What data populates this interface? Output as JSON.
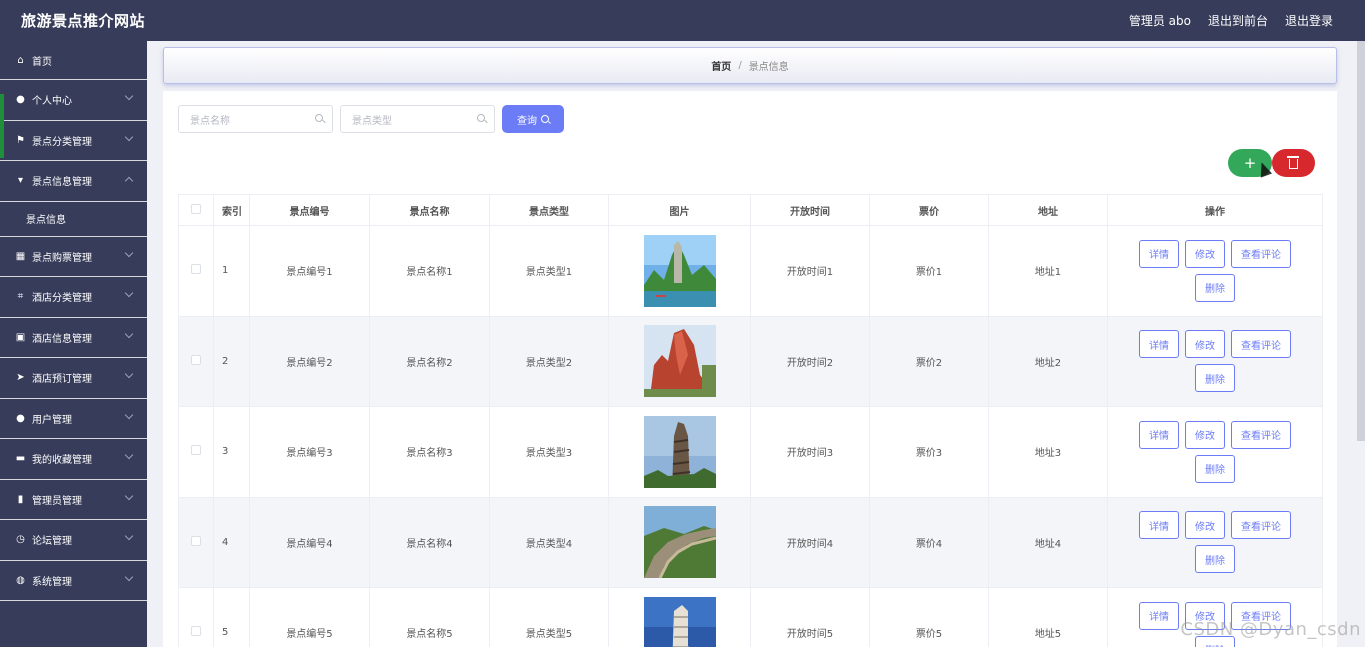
{
  "header": {
    "title": "旅游景点推介网站",
    "admin": "管理员 abo",
    "back_to_front": "退出到前台",
    "logout": "退出登录"
  },
  "sidebar": {
    "items": [
      {
        "label": "首页",
        "icon": "home-icon"
      },
      {
        "label": "个人中心",
        "icon": "user-icon"
      },
      {
        "label": "景点分类管理",
        "icon": "flag-icon"
      },
      {
        "label": "景点信息管理",
        "icon": "message-icon",
        "expanded": true,
        "sub": "景点信息"
      },
      {
        "label": "景点购票管理",
        "icon": "grid-icon"
      },
      {
        "label": "酒店分类管理",
        "icon": "crop-icon"
      },
      {
        "label": "酒店信息管理",
        "icon": "trash-icon"
      },
      {
        "label": "酒店预订管理",
        "icon": "send-icon"
      },
      {
        "label": "用户管理",
        "icon": "location-icon"
      },
      {
        "label": "我的收藏管理",
        "icon": "chat-icon"
      },
      {
        "label": "管理员管理",
        "icon": "chart-icon"
      },
      {
        "label": "论坛管理",
        "icon": "clock-icon"
      },
      {
        "label": "系统管理",
        "icon": "globe-icon"
      }
    ]
  },
  "breadcrumb": {
    "home": "首页",
    "separator": "/",
    "current": "景点信息"
  },
  "search": {
    "name_placeholder": "景点名称",
    "type_placeholder": "景点类型",
    "query_label": "查询"
  },
  "actions": {
    "add_label": "+"
  },
  "table": {
    "columns": [
      "索引",
      "景点编号",
      "景点名称",
      "景点类型",
      "图片",
      "开放时间",
      "票价",
      "地址",
      "操作"
    ],
    "rows": [
      {
        "index": "1",
        "code": "景点编号1",
        "name": "景点名称1",
        "type": "景点类型1",
        "image": "karst-peak-river",
        "open": "开放时间1",
        "price": "票价1",
        "address": "地址1"
      },
      {
        "index": "2",
        "code": "景点编号2",
        "name": "景点名称2",
        "type": "景点类型2",
        "image": "red-rock-formation",
        "open": "开放时间2",
        "price": "票价2",
        "address": "地址2"
      },
      {
        "index": "3",
        "code": "景点编号3",
        "name": "景点名称3",
        "type": "景点类型3",
        "image": "ancient-stone-pagoda",
        "open": "开放时间3",
        "price": "票价3",
        "address": "地址3"
      },
      {
        "index": "4",
        "code": "景点编号4",
        "name": "景点名称4",
        "type": "景点类型4",
        "image": "great-wall",
        "open": "开放时间4",
        "price": "票价4",
        "address": "地址4"
      },
      {
        "index": "5",
        "code": "景点编号5",
        "name": "景点名称5",
        "type": "景点类型5",
        "image": "leaning-tower",
        "open": "开放时间5",
        "price": "票价5",
        "address": "地址5"
      }
    ],
    "op_labels": {
      "detail": "详情",
      "edit": "修改",
      "comments": "查看评论",
      "delete": "删除"
    }
  },
  "watermark": "CSDN @Dyan_csdn",
  "colors": {
    "nav": "#373c5a",
    "accent": "#6c7cf7",
    "add": "#33a85a",
    "delete": "#d7282e"
  }
}
